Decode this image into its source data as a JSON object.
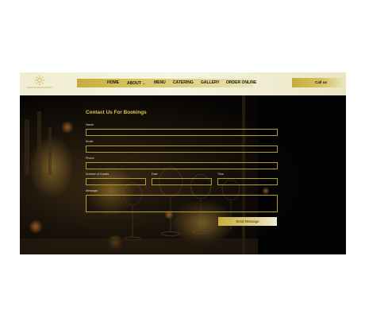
{
  "logo": {
    "text": "SAHANA RESTAURANT",
    "icon": "sun-logo-icon"
  },
  "nav": {
    "items": [
      {
        "label": "HOME"
      },
      {
        "label": "ABOUT"
      },
      {
        "label": "MENU"
      },
      {
        "label": "CATERING"
      },
      {
        "label": "GALLERY"
      },
      {
        "label": "ORDER ONLINE"
      }
    ],
    "about_chevron": "⌄",
    "call_label": "Call us"
  },
  "form": {
    "title": "Contact Us For Bookings",
    "name_label": "Name:",
    "email_label": "Email:",
    "phone_label": "Phone:",
    "guests_label": "Number of Guests",
    "date_label": "Date",
    "time_label": "Time",
    "message_label": "Message:",
    "name_value": "",
    "email_value": "",
    "phone_value": "",
    "guests_value": "",
    "date_value": "",
    "time_value": "",
    "message_value": "",
    "submit_label": "Send Message"
  },
  "colors": {
    "accent_gold": "#d9c246",
    "header_bg": "#f2efd6",
    "dark_bg": "#050403",
    "field_border": "#b59a2c"
  }
}
